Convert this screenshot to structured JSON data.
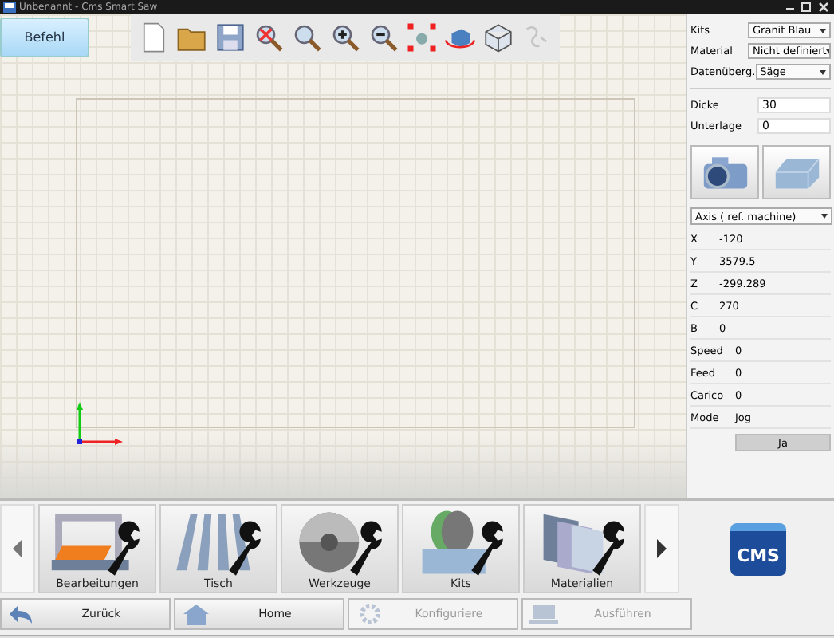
{
  "window": {
    "title": "Unbenannt - Cms Smart Saw"
  },
  "command_button": "Befehl",
  "toolbar": [
    {
      "kind": "new",
      "disabled": false
    },
    {
      "kind": "open",
      "disabled": false
    },
    {
      "kind": "save",
      "disabled": false
    },
    {
      "kind": "zoom-reset",
      "disabled": false
    },
    {
      "kind": "zoom-window",
      "disabled": false
    },
    {
      "kind": "zoom-in",
      "disabled": false
    },
    {
      "kind": "zoom-out",
      "disabled": false
    },
    {
      "kind": "fit",
      "disabled": false
    },
    {
      "kind": "rotate",
      "disabled": false
    },
    {
      "kind": "box",
      "disabled": false
    },
    {
      "kind": "pointer",
      "disabled": true
    }
  ],
  "panel": {
    "settings": [
      {
        "label": "Kits",
        "value": "Granit Blau"
      },
      {
        "label": "Material",
        "value": "Nicht definiert"
      },
      {
        "label": "Datenüberg.",
        "value": "Säge"
      }
    ],
    "inputs": [
      {
        "label": "Dicke",
        "value": "30"
      },
      {
        "label": "Unterlage",
        "value": "0"
      }
    ],
    "axis_select": "Axis ( ref. machine)",
    "axes": [
      {
        "label": "X",
        "value": "-120"
      },
      {
        "label": "Y",
        "value": "3579.5"
      },
      {
        "label": "Z",
        "value": "-299.289"
      },
      {
        "label": "C",
        "value": "270"
      },
      {
        "label": "B",
        "value": "0"
      }
    ],
    "status": [
      {
        "label": "Speed",
        "value": "0"
      },
      {
        "label": "Feed",
        "value": "0"
      },
      {
        "label": "Carico",
        "value": "0"
      },
      {
        "label": "Mode",
        "value": "Jog"
      }
    ],
    "confirm_button": "Ja"
  },
  "categories": [
    {
      "label": "Bearbeitungen",
      "kind": "machine"
    },
    {
      "label": "Tisch",
      "kind": "table"
    },
    {
      "label": "Werkzeuge",
      "kind": "blade"
    },
    {
      "label": "Kits",
      "kind": "kits"
    },
    {
      "label": "Materialien",
      "kind": "slabs"
    }
  ],
  "logo": "CMS",
  "nav": [
    {
      "label": "Zurück",
      "kind": "back",
      "disabled": false
    },
    {
      "label": "Home",
      "kind": "home",
      "disabled": false
    },
    {
      "label": "Konfiguriere",
      "kind": "gear",
      "disabled": true
    },
    {
      "label": "Ausführen",
      "kind": "laptop",
      "disabled": true
    }
  ]
}
